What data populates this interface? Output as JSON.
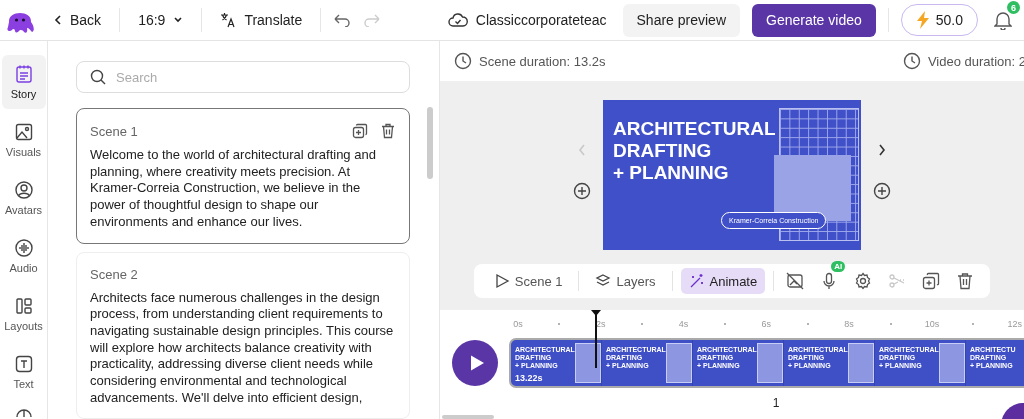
{
  "header": {
    "back": "Back",
    "aspect": "16:9",
    "translate": "Translate",
    "undo_disabled": false,
    "redo_disabled": true,
    "project": "Classiccorporateteac",
    "share": "Share preview",
    "generate": "Generate video",
    "credits": "50.0",
    "notifications": "6"
  },
  "rail": [
    {
      "label": "Story",
      "selected": true
    },
    {
      "label": "Visuals",
      "selected": false
    },
    {
      "label": "Avatars",
      "selected": false
    },
    {
      "label": "Audio",
      "selected": false
    },
    {
      "label": "Layouts",
      "selected": false
    },
    {
      "label": "Text",
      "selected": false
    }
  ],
  "search": {
    "placeholder": "Search"
  },
  "scenes": [
    {
      "title": "Scene 1",
      "selected": true,
      "text": "Welcome to the world of architectural drafting and planning, where creativity meets precision. At Kramer-Correia Construction, we believe in the power of thoughtful design to shape our environments and enhance our lives."
    },
    {
      "title": "Scene 2",
      "selected": false,
      "text": "Architects face numerous challenges in the design process, from understanding client requirements to navigating sustainable design principles. This course will explore how architects balance creativity with practicality, addressing diverse client needs while considering environmental and technological advancements. We'll delve into efficient design,"
    }
  ],
  "info": {
    "scene_duration": "Scene duration: 13.2s",
    "video_duration": "Video duration: 2"
  },
  "slide": {
    "title_lines": [
      "ARCHITECTURAL",
      "DRAFTING",
      "+ PLANNING"
    ],
    "pill": "Kramer-Correia Construction",
    "prev_disabled": true,
    "next_disabled": false
  },
  "toolbar": {
    "buttons": [
      {
        "label": "Scene 1",
        "selected": false
      },
      {
        "label": "Layers",
        "selected": false
      },
      {
        "label": "Animate",
        "selected": true
      }
    ],
    "tools": [
      {
        "disabled": false
      },
      {
        "disabled": false,
        "badge": "AI"
      },
      {
        "disabled": false
      },
      {
        "disabled": true
      },
      {
        "disabled": false
      },
      {
        "disabled": false
      }
    ]
  },
  "timeline": {
    "ticks": [
      "0s",
      "2s",
      "4s",
      "6s",
      "8s",
      "10s",
      "12s"
    ],
    "duration": "13.22s",
    "scene_number": "1",
    "thumbnails": [
      {
        "lines": [
          "ARCHITECTURAL",
          "DRAFTING",
          "+ PLANNING"
        ]
      },
      {
        "lines": [
          "ARCHITECTURAL",
          "DRAFTING",
          "+ PLANNING"
        ]
      },
      {
        "lines": [
          "ARCHITECTURAL",
          "DRAFTING",
          "+ PLANNING"
        ]
      },
      {
        "lines": [
          "ARCHITECTURAL",
          "DRAFTING",
          "+ PLANNING"
        ]
      },
      {
        "lines": [
          "ARCHITECTURAL",
          "DRAFTING",
          "+ PLANNING"
        ]
      },
      {
        "lines": [
          "ARCHITECTU",
          "DRAFTING",
          "+ PLANNING"
        ]
      }
    ]
  }
}
